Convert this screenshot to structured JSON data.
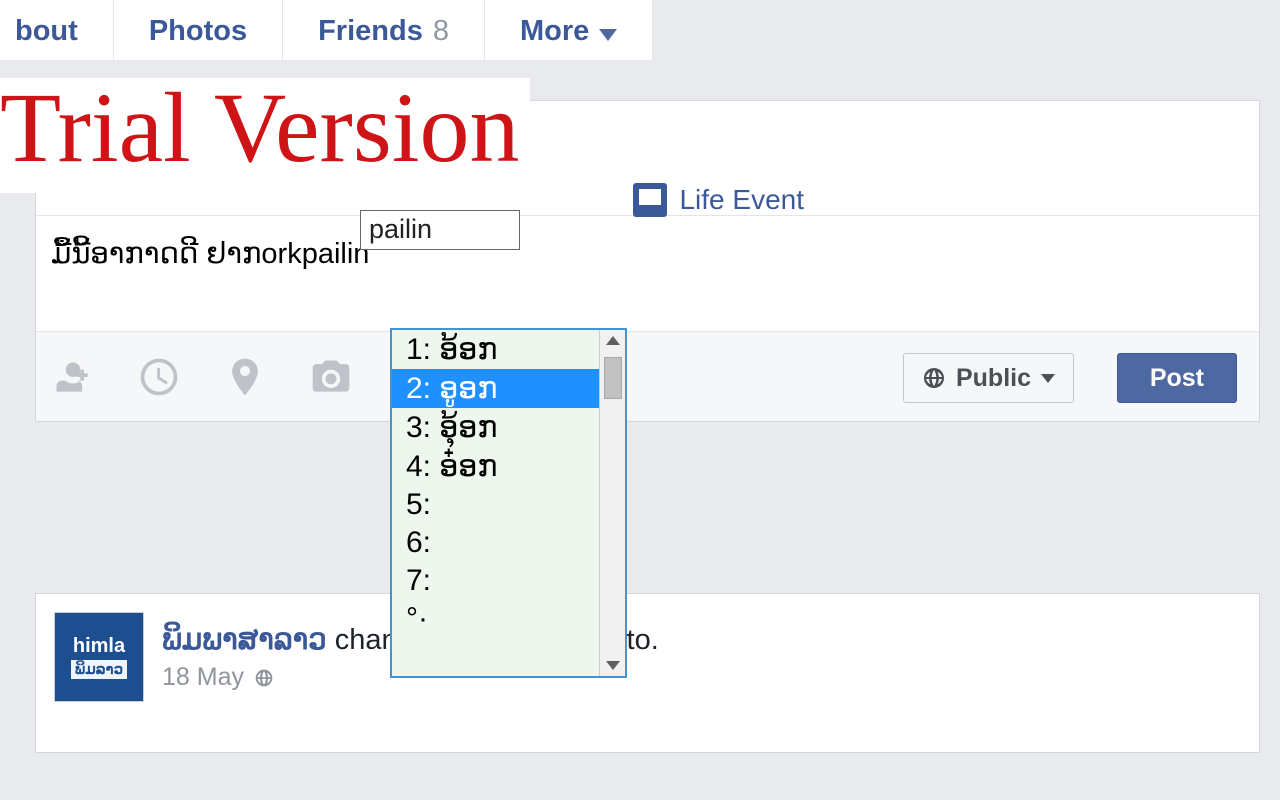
{
  "nav": {
    "about": "bout",
    "photos": "Photos",
    "friends": "Friends",
    "friends_count": "8",
    "more": "More"
  },
  "composer": {
    "life_event": "Life Event",
    "ime_small": "pailin",
    "text": "ມື້ນີ້ອາກາດດີ ຢາກorkpailin",
    "privacy": "Public",
    "post": "Post"
  },
  "ime": {
    "items": [
      {
        "n": "1:",
        "t": "ອ້ອກ"
      },
      {
        "n": "2:",
        "t": "ອູອກ"
      },
      {
        "n": "3:",
        "t": "ອຸ້ອກ"
      },
      {
        "n": "4:",
        "t": "ອ໋ອກ"
      },
      {
        "n": "5:",
        "t": ""
      },
      {
        "n": "6:",
        "t": ""
      },
      {
        "n": "7:",
        "t": ""
      },
      {
        "n": "°·",
        "t": ""
      }
    ],
    "selected_index": 1
  },
  "story": {
    "avatar_l1": "himla",
    "avatar_l2": "ພິມລາວ",
    "name": "ພິມພາສາລາວ",
    "action": " changed his cover photo.",
    "date": "18 May"
  },
  "watermark": "Trial Version"
}
